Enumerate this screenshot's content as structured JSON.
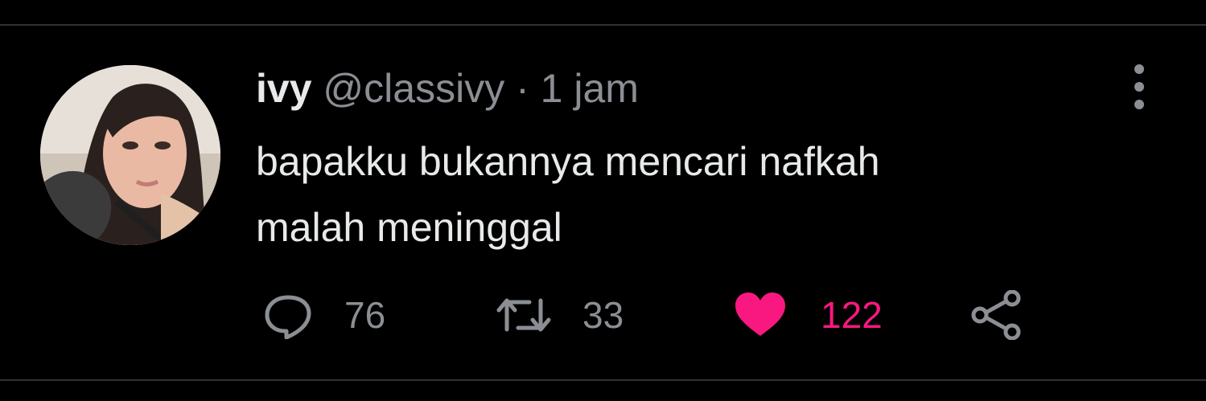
{
  "tweet": {
    "display_name": "ivy",
    "handle": "@classivy",
    "separator": "·",
    "time": "1 jam",
    "text_lines": [
      "bapakku bukannya mencari nafkah",
      "malah meninggal"
    ]
  },
  "actions": {
    "reply_count": "76",
    "retweet_count": "33",
    "like_count": "122"
  },
  "colors": {
    "background": "#000000",
    "divider": "#2f3336",
    "text": "#e7e9ea",
    "secondary": "#8b8f94",
    "like": "#f91880"
  },
  "icons": {
    "reply": "speech-bubble-icon",
    "retweet": "retweet-arrows-icon",
    "like": "heart-filled-icon",
    "share": "share-nodes-icon",
    "more": "vertical-dots-icon"
  }
}
